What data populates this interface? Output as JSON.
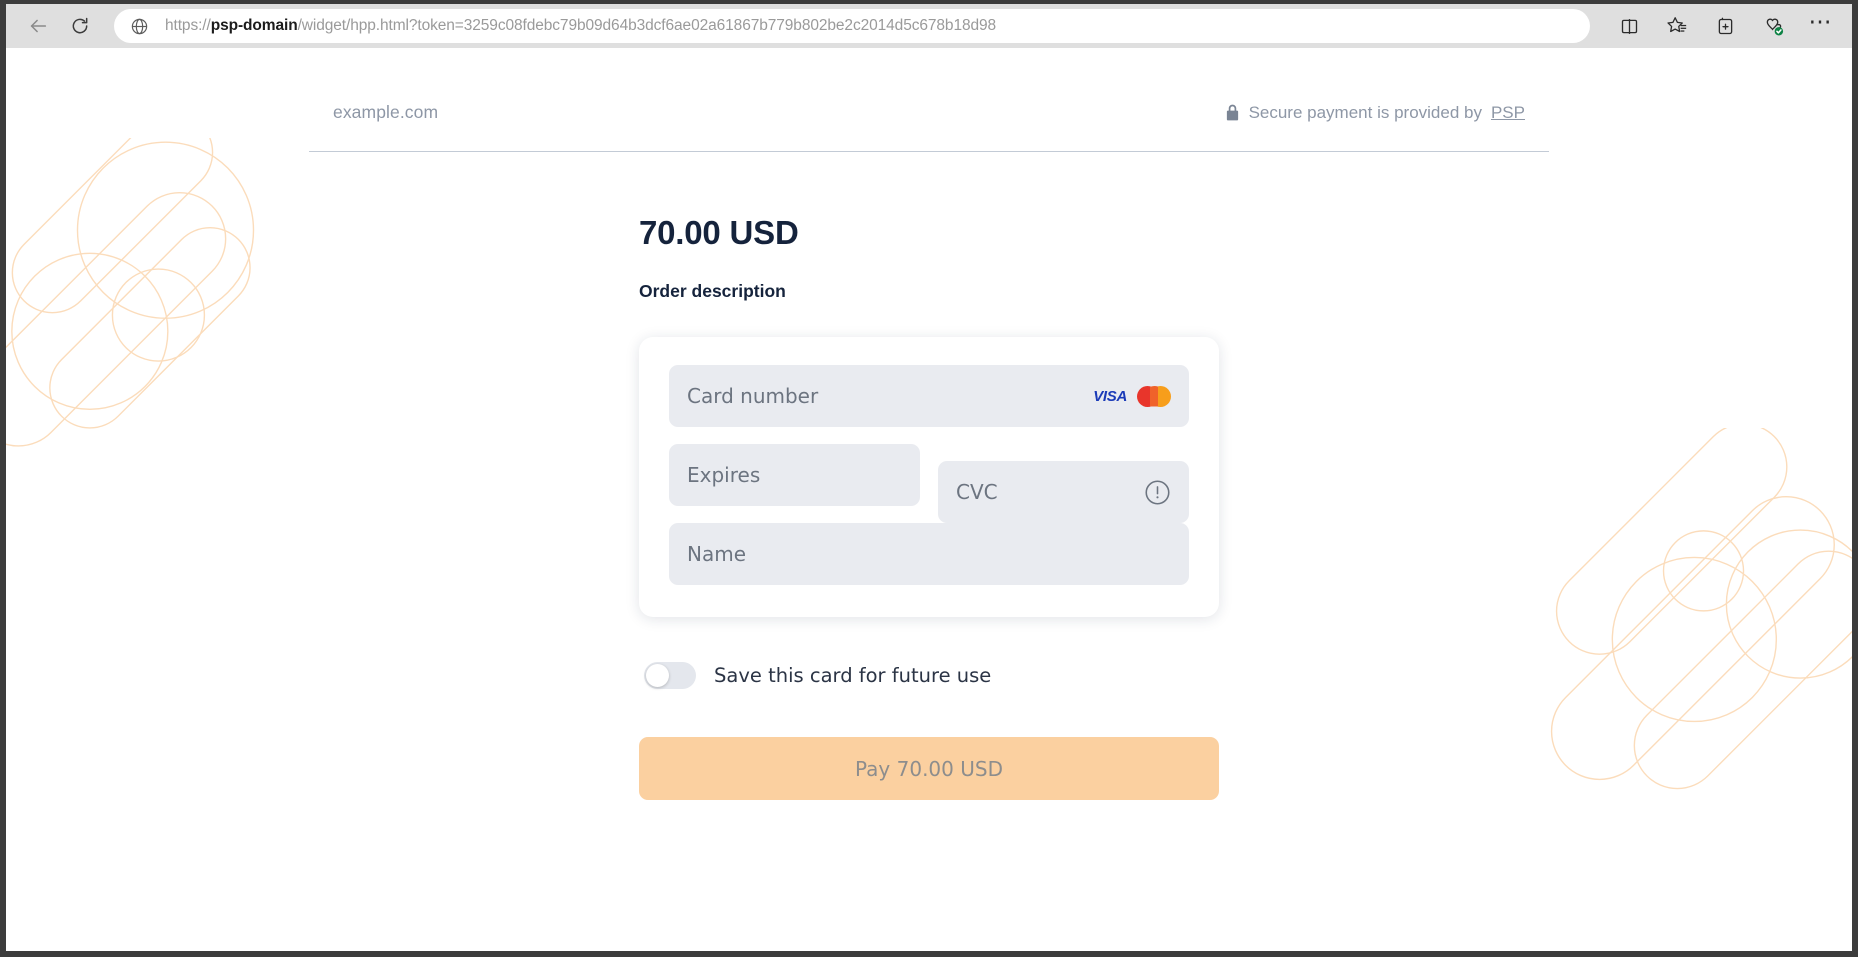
{
  "browser": {
    "back_icon": "back-arrow-icon",
    "reload_icon": "reload-icon",
    "site_icon": "globe-icon",
    "url_full": "https://psp-domain/widget/hpp.html?token=3259c08fdebc79b09d64b3dcf6ae02a61867b779b802be2c2014d5c678b18d98",
    "url_scheme": "https://",
    "url_host": "psp-domain",
    "url_path": "/widget/hpp.html?token=3259c08fdebc79b09d64b3dcf6ae02a61867b779b802be2c2014d5c678b18d98",
    "actions": [
      {
        "name": "split-screen-icon",
        "label": "Split screen"
      },
      {
        "name": "favorites-icon",
        "label": "Favorites"
      },
      {
        "name": "collections-icon",
        "label": "Add to Collections"
      },
      {
        "name": "browser-essentials-icon",
        "label": "Browser essentials"
      },
      {
        "name": "settings-more-icon",
        "label": "Settings and more"
      }
    ],
    "more_glyph": "⋯"
  },
  "hpp": {
    "merchant": "example.com",
    "secure_text_prefix": "Secure payment is provided by",
    "secure_link_label": "PSP",
    "lock_icon": "lock-icon",
    "amount": "70.00 USD",
    "order_description": "Order description",
    "form": {
      "card_number_placeholder": "Card number",
      "expires_placeholder": "Expires",
      "cvc_placeholder": "CVC",
      "name_placeholder": "Name",
      "card_number_value": "",
      "expires_value": "",
      "cvc_value": "",
      "name_value": "",
      "visa_label": "VISA",
      "mastercard_icon": "mastercard-icon",
      "cvc_help_icon": "exclamation-circle-icon"
    },
    "save_card_label": "Save this card for future use",
    "save_card_enabled": false,
    "pay_button_label": "Pay 70.00 USD",
    "pay_button_disabled": true,
    "colors": {
      "accent": "#fbd0a0",
      "field_bg": "#e9ebf0",
      "heading": "#15233c",
      "muted": "#8e97a6",
      "watermark": "#fce5cd"
    }
  }
}
